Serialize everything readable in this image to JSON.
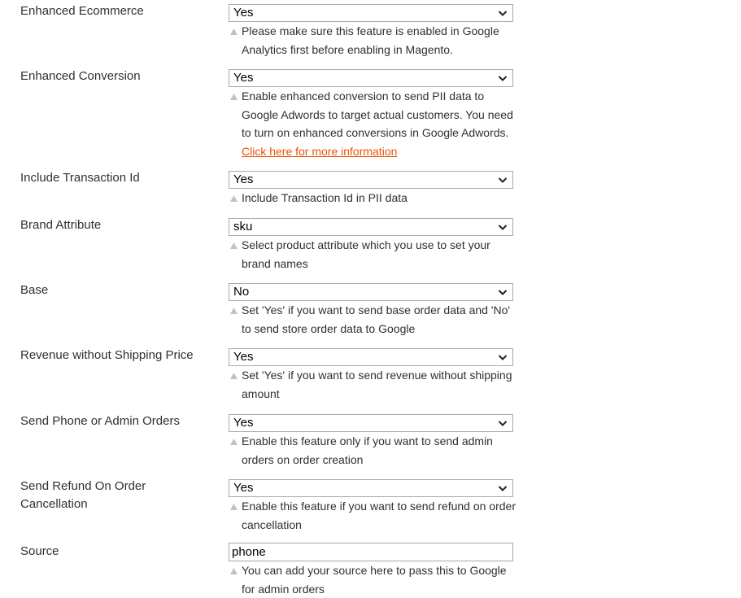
{
  "colors": {
    "link": "#eb5202",
    "text": "#303030",
    "border": "#a9a9a9",
    "triangle": "#c2c2c2"
  },
  "icons": {
    "dropdown": "chevron-down-icon",
    "note": "triangle-up-icon"
  },
  "fields": [
    {
      "label": "Enhanced Ecommerce",
      "value": "Yes",
      "note": "Please make sure this feature is enabled in Google Analytics first before enabling in Magento."
    },
    {
      "label": "Enhanced Conversion",
      "value": "Yes",
      "note": "Enable enhanced conversion to send PII data to Google Adwords to target actual customers. You need to turn on enhanced conversions in Google Adwords.",
      "link": "Click here for more information"
    },
    {
      "label": "Include Transaction Id",
      "value": "Yes",
      "note": "Include Transaction Id in PII data"
    },
    {
      "label": "Brand Attribute",
      "value": "sku",
      "note": "Select product attribute which you use to set your brand names"
    },
    {
      "label": "Base",
      "value": "No",
      "note": "Set 'Yes' if you want to send base order data and 'No' to send store order data to Google"
    },
    {
      "label": "Revenue without Shipping Price",
      "value": "Yes",
      "note": "Set 'Yes' if you want to send revenue without shipping amount"
    },
    {
      "label": "Send Phone or Admin Orders",
      "value": "Yes",
      "note": "Enable this feature only if you want to send admin orders on order creation"
    },
    {
      "label": "Send Refund On Order Cancellation",
      "value": "Yes",
      "note": "Enable this feature if you want to send refund on order cancellation"
    },
    {
      "label": "Source",
      "value": "phone",
      "note": "You can add your source here to pass this to Google for admin orders"
    }
  ]
}
